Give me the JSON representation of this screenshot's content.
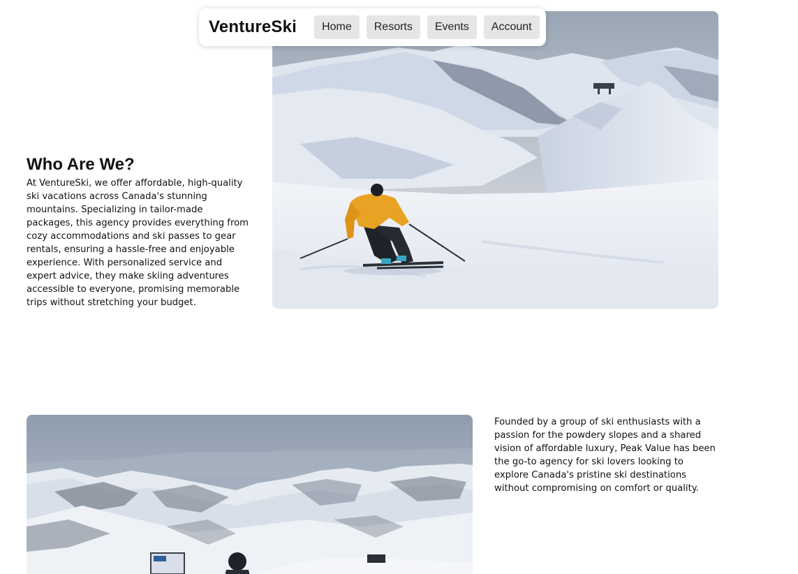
{
  "nav": {
    "brand": "VentureSki",
    "items": [
      {
        "label": "Home"
      },
      {
        "label": "Resorts"
      },
      {
        "label": "Events"
      },
      {
        "label": "Account"
      }
    ]
  },
  "section1": {
    "heading": "Who Are We?",
    "paragraph": "At VentureSki, we offer affordable, high-quality ski vacations across Canada's stunning mountains. Specializing in tailor-made packages, this agency provides everything from cozy accommodations and ski passes to gear rentals, ensuring a hassle-free and enjoyable experience. With personalized service and expert advice, they make skiing adventures accessible to everyone, promising memorable trips without stretching your budget.",
    "image": "skier-on-slope-photo"
  },
  "section2": {
    "paragraph": "Founded by a group of ski enthusiasts with a passion for the powdery slopes and a shared vision of affordable luxury, Peak Value has been the go-to agency for ski lovers looking to explore Canada's pristine ski destinations without compromising on comfort or quality.",
    "image": "mountain-range-photo"
  },
  "colors": {
    "nav_button_bg": "#e6e6e6",
    "skier_jacket": "#e8a224",
    "snow": "#eef2f8",
    "sky": "#b8c4d4"
  }
}
